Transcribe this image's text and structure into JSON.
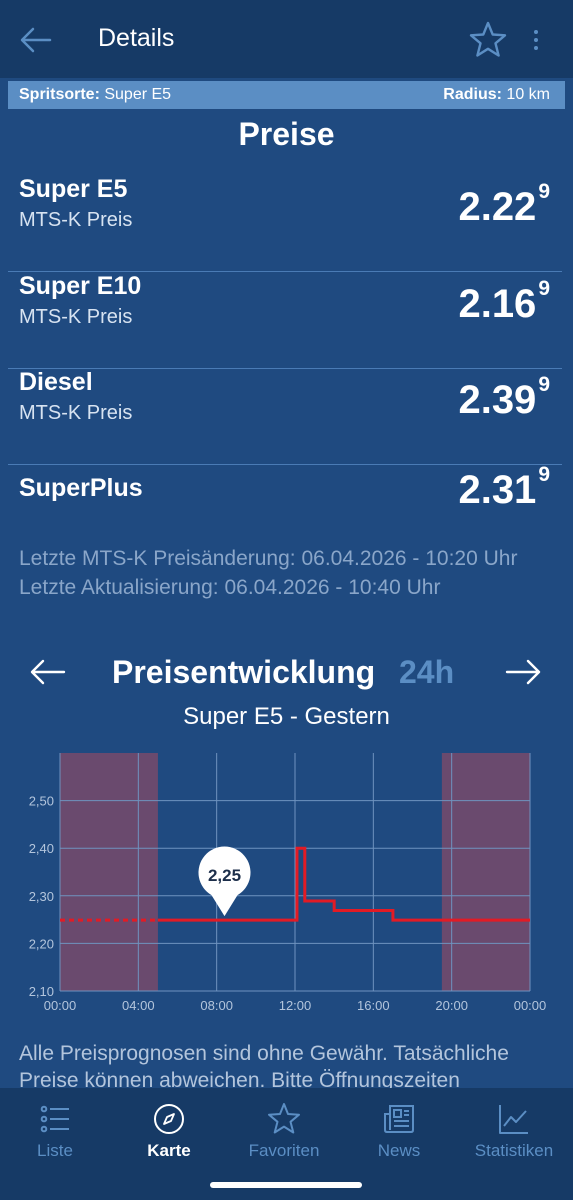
{
  "appbar": {
    "title": "Details"
  },
  "filter": {
    "fuel_label": "Spritsorte:",
    "fuel_value": "Super E5",
    "radius_label": "Radius:",
    "radius_value": "10 km"
  },
  "prices": {
    "title": "Preise",
    "items": [
      {
        "name": "Super E5",
        "sub": "MTS-K Preis",
        "price": "2.22",
        "sup": "9"
      },
      {
        "name": "Super E10",
        "sub": "MTS-K Preis",
        "price": "2.16",
        "sup": "9"
      },
      {
        "name": "Diesel",
        "sub": "MTS-K Preis",
        "price": "2.39",
        "sup": "9"
      },
      {
        "name": "SuperPlus",
        "sub": "",
        "price": "2.31",
        "sup": "9"
      }
    ]
  },
  "info": {
    "last_change": "Letzte MTS-K Preisänderung: 06.04.2026 - 10:20 Uhr",
    "last_update": "Letzte Aktualisierung: 06.04.2026 - 10:40 Uhr"
  },
  "trend": {
    "title": "Preisentwicklung",
    "range": "24h",
    "subtitle": "Super E5 - Gestern"
  },
  "chart_data": {
    "type": "line",
    "title": "",
    "x_unit": "hours",
    "xlim": [
      0,
      24
    ],
    "ylim": [
      2.1,
      2.6
    ],
    "x_ticks": [
      "00:00",
      "04:00",
      "08:00",
      "12:00",
      "16:00",
      "20:00",
      "00:00"
    ],
    "y_ticks": [
      "2,10",
      "2,20",
      "2,30",
      "2,40",
      "2,50"
    ],
    "closed_ranges": [
      [
        0,
        5
      ],
      [
        19.5,
        24
      ]
    ],
    "dashed_until": 5,
    "series": [
      {
        "x": [
          0,
          12.1,
          12.1,
          12.5,
          12.5,
          14,
          14,
          17,
          17,
          24
        ],
        "y": [
          2.249,
          2.249,
          2.4,
          2.4,
          2.289,
          2.289,
          2.269,
          2.269,
          2.249,
          2.249
        ],
        "color": "#e21b25"
      }
    ],
    "marker": {
      "x": 8.4,
      "y": 2.249,
      "label": "2,25"
    }
  },
  "disclaimer": "Alle Preisprognosen sind ohne Gewähr. Tatsächliche Preise können abweichen. Bitte Öffnungszeiten",
  "nav": {
    "items": [
      {
        "label": "Liste",
        "icon": "list-icon"
      },
      {
        "label": "Karte",
        "icon": "compass-icon"
      },
      {
        "label": "Favoriten",
        "icon": "star-icon"
      },
      {
        "label": "News",
        "icon": "newspaper-icon"
      },
      {
        "label": "Statistiken",
        "icon": "chart-icon"
      }
    ]
  },
  "colors": {
    "background": "#1f4a80",
    "bar": "#163a66",
    "accent": "#5b8ec4",
    "line": "#e21b25",
    "closed": "#6a4a6e"
  }
}
